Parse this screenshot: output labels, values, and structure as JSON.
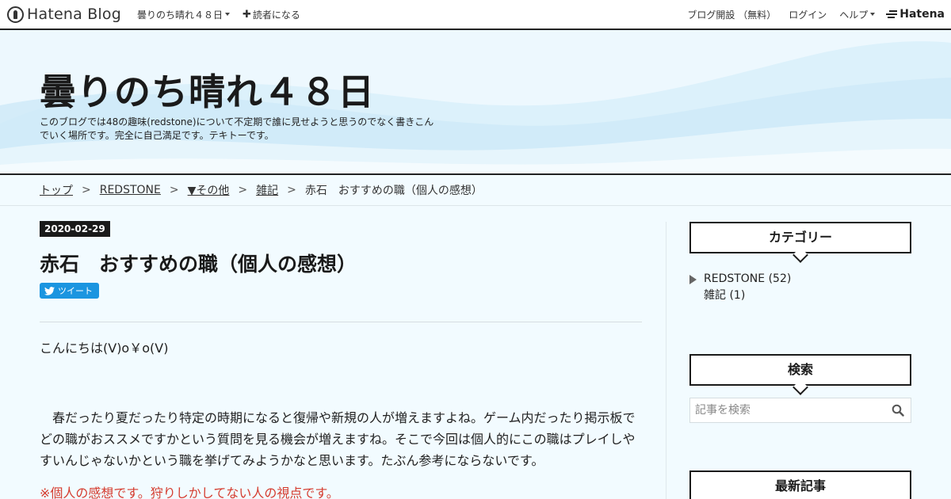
{
  "globalbar": {
    "logo_text": "Hatena Blog",
    "blog_menu_label": "曇りのち晴れ４８日",
    "subscribe_label": "読者になる",
    "open_blog_label": "ブログ開設 （無料）",
    "login_label": "ログイン",
    "help_label": "ヘルプ",
    "brand_label": "Hatena"
  },
  "header": {
    "title": "曇りのち晴れ４８日",
    "description": "このブログでは48の趣味(redstone)について不定期で誰に見せようと思うのでなく書きこんでいく場所です。完全に自己満足です。テキトーです。"
  },
  "breadcrumb": {
    "items": [
      "トップ",
      "REDSTONE",
      "▼その他",
      "雑記"
    ],
    "current": "赤石　おすすめの職（個人の感想）",
    "separator": ">"
  },
  "entry": {
    "date": "2020-02-29",
    "title": "赤石　おすすめの職（個人の感想）",
    "tweet_label": "ツイート",
    "greeting": "こんにちは(V)o￥o(V)",
    "paragraph": "　春だったり夏だったり特定の時期になると復帰や新規の人が増えますよね。ゲーム内だったり掲示板でどの職がおススメですかという質問を見る機会が増えますね。そこで今回は個人的にこの職はプレイしやすいんじゃないかという職を挙げてみようかなと思います。たぶん参考にならないです。",
    "note": "※個人の感想です。狩りしかしてない人の視点です。"
  },
  "sidebar": {
    "categories_title": "カテゴリー",
    "categories": [
      {
        "label": "REDSTONE (52)"
      },
      {
        "label": "雑記 (1)"
      }
    ],
    "search_title": "検索",
    "search_placeholder": "記事を検索",
    "recent_title": "最新記事"
  },
  "colors": {
    "accent_dark": "#1a1a1a",
    "tweet_blue": "#1b95e0",
    "note_red": "#d53c2f",
    "background": "#f2fbff"
  }
}
